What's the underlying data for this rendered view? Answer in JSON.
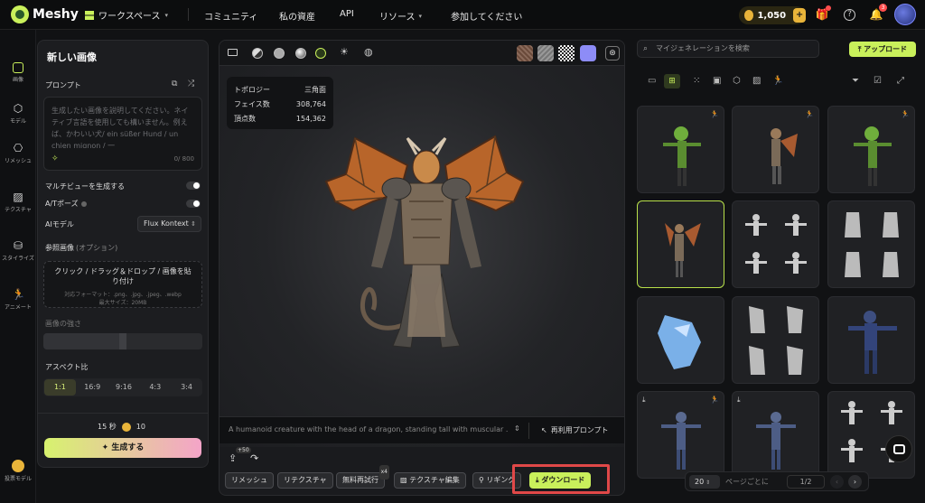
{
  "topnav": {
    "brand": "Meshy",
    "workspace": "ワークスペース",
    "items": [
      "コミュニティ",
      "私の資産",
      "API",
      "リソース",
      "参加してください"
    ],
    "credits": "1,050",
    "notification_count": "3"
  },
  "rail": {
    "items": [
      {
        "label": "画像",
        "icon": "image-icon"
      },
      {
        "label": "モデル",
        "icon": "cube-icon"
      },
      {
        "label": "リメッシュ",
        "icon": "mesh-icon"
      },
      {
        "label": "テクスチャ",
        "icon": "texture-icon"
      },
      {
        "label": "スタイライズ",
        "icon": "stylize-icon"
      },
      {
        "label": "アニメート",
        "icon": "run-icon"
      }
    ],
    "feedback": "投票モデル"
  },
  "left_panel": {
    "title": "新しい画像",
    "prompt_label": "プロンプト",
    "prompt_placeholder": "生成したい画像を説明してください。ネイティブ言語を使用しても構いません。例えば、かわいい犬/ ein süßer Hund / un chien mignon / 一",
    "char_count": "0/ 800",
    "multiview_label": "マルチビューを生成する",
    "apose_label": "A/Tポーズ",
    "ai_model_label": "AIモデル",
    "ai_model_value": "Flux Kontext",
    "reference_label": "参照画像",
    "reference_optional": "(オプション)",
    "upload_text": "クリック / ドラッグ＆ドロップ / 画像を貼り付け",
    "upload_formats": "対応フォーマット：.png、.jpg、.jpeg、.webp",
    "upload_maxsize": "最大サイズ：20MB",
    "strength_label": "画像の強さ",
    "strength_value": 0.5,
    "aspect_label": "アスペクト比",
    "aspect_options": [
      "1:1",
      "16:9",
      "9:16",
      "4:3",
      "3:4"
    ],
    "aspect_selected": "1:1",
    "cost_time": "15 秒",
    "cost_credits": "10",
    "generate_button": "生成する"
  },
  "viewer": {
    "stats": [
      {
        "label": "トポロジー",
        "value": "三角面"
      },
      {
        "label": "フェイス数",
        "value": "308,764"
      },
      {
        "label": "頂点数",
        "value": "154,362"
      }
    ],
    "prompt_text": "A humanoid creature with the head of a dragon, standing tall with muscular ...",
    "reuse_prompt": "再利用プロンプト",
    "remix_badge": "+50",
    "actions": {
      "remesh": "リメッシュ",
      "retexture": "リテクスチャ",
      "free_retry": "無料再試行",
      "free_retry_badge": "x4",
      "texture_edit": "テクスチャ編集",
      "rigging": "リギング",
      "download": "ダウンロード"
    }
  },
  "right_panel": {
    "search_placeholder": "マイジェネレーションを検索",
    "upload_button": "アップロード",
    "pager": {
      "per_page": "20",
      "per_page_label": "ページごとに",
      "page": "1/2"
    }
  },
  "colors": {
    "accent": "#c9f05b",
    "highlight": "#e04848",
    "coin": "#e9b43a"
  }
}
